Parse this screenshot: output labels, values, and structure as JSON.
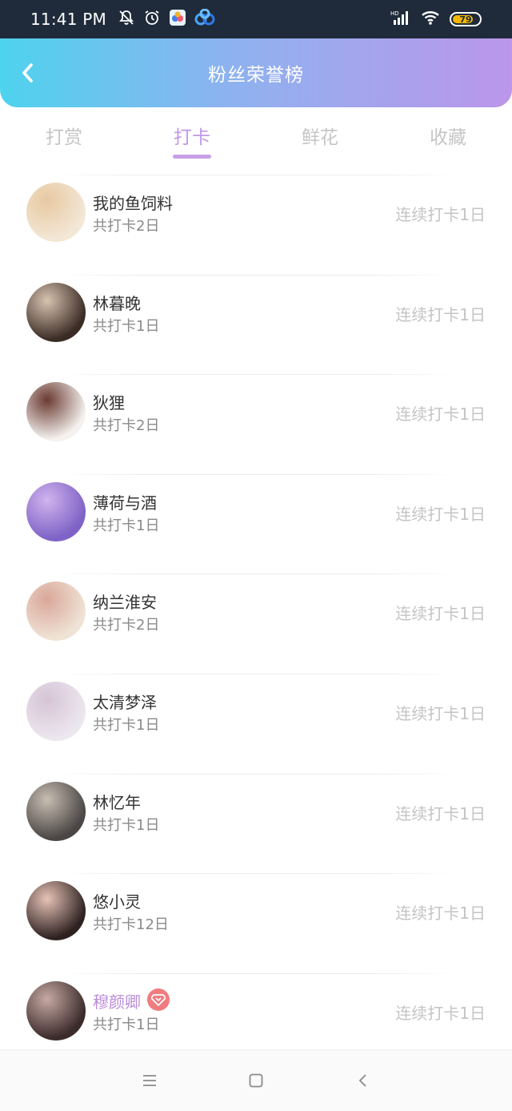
{
  "status_bar": {
    "time": "11:41 PM",
    "battery": "79",
    "battery_level": 0.79,
    "icons_left": [
      "mute-bell-icon",
      "alarm-icon",
      "app-badge-icon",
      "cloud-app-icon"
    ],
    "icons_right": [
      "hd-signal-icon",
      "wifi-icon",
      "battery-icon"
    ]
  },
  "header": {
    "title": "粉丝荣誉榜",
    "back_icon": "chevron-left-icon"
  },
  "tabs": [
    {
      "label": "打赏",
      "active": false
    },
    {
      "label": "打卡",
      "active": true
    },
    {
      "label": "鲜花",
      "active": false
    },
    {
      "label": "收藏",
      "active": false
    }
  ],
  "colors": {
    "accent": "#c297e5",
    "header_start": "#4ed3ee",
    "header_end": "#bb96ea",
    "vip_badge": "#f07c80"
  },
  "list": [
    {
      "name": "我的鱼饲料",
      "total": "共打卡2日",
      "streak": "连续打卡1日",
      "vip": false,
      "avatar": [
        "#f3e7d6",
        "#e7c9a1"
      ]
    },
    {
      "name": "林暮晚",
      "total": "共打卡1日",
      "streak": "连续打卡1日",
      "vip": false,
      "avatar": [
        "#3a2c25",
        "#d9c3b1"
      ]
    },
    {
      "name": "狄狸",
      "total": "共打卡2日",
      "streak": "连续打卡1日",
      "vip": false,
      "avatar": [
        "#f4f1ee",
        "#6b3a32"
      ]
    },
    {
      "name": "薄荷与酒",
      "total": "共打卡1日",
      "streak": "连续打卡1日",
      "vip": false,
      "avatar": [
        "#7e62c6",
        "#d0b3ee"
      ]
    },
    {
      "name": "纳兰淮安",
      "total": "共打卡2日",
      "streak": "连续打卡1日",
      "vip": false,
      "avatar": [
        "#efe3d5",
        "#d9a79a"
      ]
    },
    {
      "name": "太清梦泽",
      "total": "共打卡1日",
      "streak": "连续打卡1日",
      "vip": false,
      "avatar": [
        "#ece6ee",
        "#d6c4d6"
      ]
    },
    {
      "name": "林忆年",
      "total": "共打卡1日",
      "streak": "连续打卡1日",
      "vip": false,
      "avatar": [
        "#4a4645",
        "#c8bdb1"
      ]
    },
    {
      "name": "悠小灵",
      "total": "共打卡12日",
      "streak": "连续打卡1日",
      "vip": false,
      "avatar": [
        "#2e2221",
        "#e7c3b7"
      ]
    },
    {
      "name": "穆颜卿",
      "total": "共打卡1日",
      "streak": "连续打卡1日",
      "vip": true,
      "avatar": [
        "#3b2b2b",
        "#c7a9a3"
      ]
    }
  ],
  "navbar": {
    "icons": [
      "menu-icon",
      "home-square-icon",
      "back-triangle-icon"
    ]
  }
}
